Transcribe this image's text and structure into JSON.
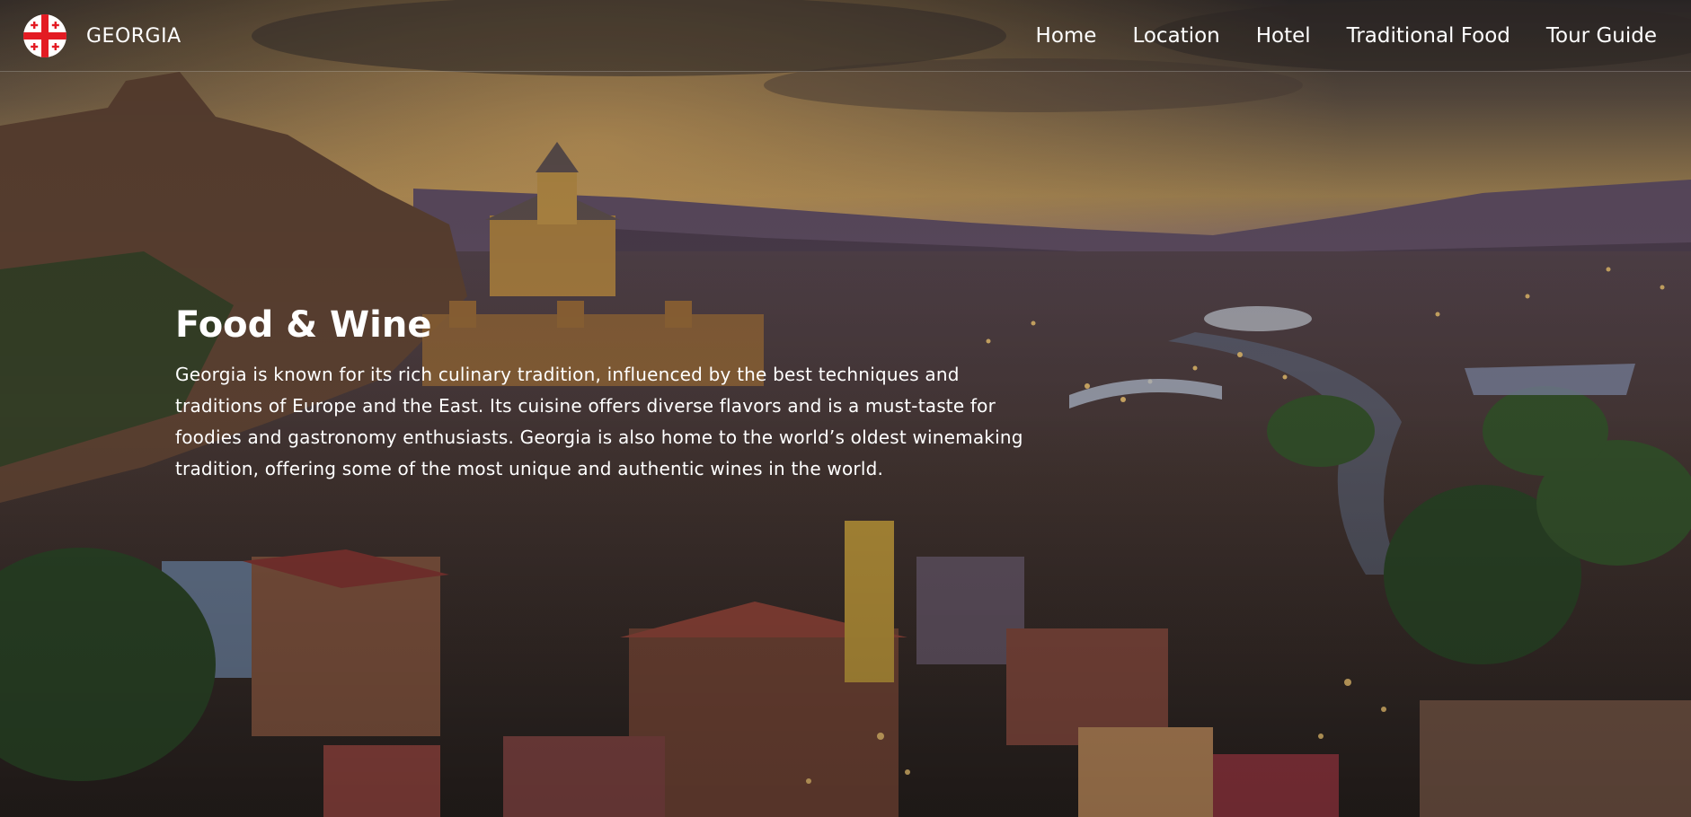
{
  "navbar": {
    "brand": {
      "name": "GEORGIA",
      "logo_icon": "georgia-flag-icon"
    },
    "links": [
      {
        "label": "Home"
      },
      {
        "label": "Location"
      },
      {
        "label": "Hotel"
      },
      {
        "label": "Traditional Food"
      },
      {
        "label": "Tour Guide"
      }
    ]
  },
  "hero": {
    "title": "Food & Wine",
    "description": "Georgia is known for its rich culinary tradition, influenced by the best techniques and traditions of Europe and the East. Its cuisine offers diverse flavors and is a must-taste for foodies and gastronomy enthusiasts. Georgia is also home to the world’s oldest winemaking tradition, offering some of the most unique and authentic wines in the world.",
    "background_image": "tbilisi-cityscape-at-dusk"
  },
  "colors": {
    "text": "#ffffff",
    "flag_white": "#ffffff",
    "flag_red": "#e31b23"
  }
}
